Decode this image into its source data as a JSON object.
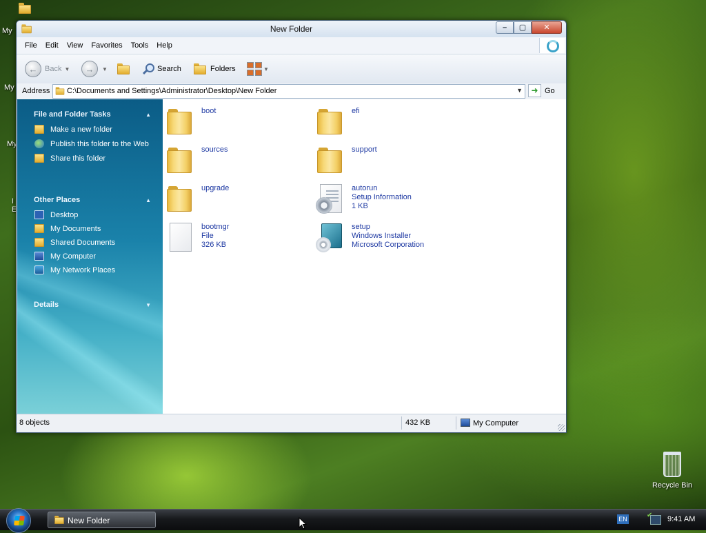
{
  "desktop": {
    "icons": [
      {
        "label": "My",
        "name": "desktop-icon-my-documents"
      },
      {
        "label": "My",
        "name": "desktop-icon-my-computer"
      },
      {
        "label": "My",
        "name": "desktop-icon-my-network"
      },
      {
        "label": "I E",
        "name": "desktop-icon-internet-explorer"
      }
    ],
    "recycle_bin": "Recycle Bin"
  },
  "window": {
    "title": "New Folder",
    "menu": [
      "File",
      "Edit",
      "View",
      "Favorites",
      "Tools",
      "Help"
    ],
    "toolbar": {
      "back": "Back",
      "search": "Search",
      "folders": "Folders"
    },
    "address": {
      "label": "Address",
      "path": "C:\\Documents and Settings\\Administrator\\Desktop\\New Folder",
      "go": "Go"
    },
    "taskpane": {
      "file_tasks": {
        "title": "File and Folder Tasks",
        "items": [
          "Make a new folder",
          "Publish this folder to the Web",
          "Share this folder"
        ]
      },
      "other_places": {
        "title": "Other Places",
        "items": [
          "Desktop",
          "My Documents",
          "Shared Documents",
          "My Computer",
          "My Network Places"
        ]
      },
      "details": {
        "title": "Details"
      }
    },
    "files": [
      {
        "name": "boot",
        "line2": "",
        "line3": "",
        "type": "folder"
      },
      {
        "name": "efi",
        "line2": "",
        "line3": "",
        "type": "folder"
      },
      {
        "name": "sources",
        "line2": "",
        "line3": "",
        "type": "folder"
      },
      {
        "name": "support",
        "line2": "",
        "line3": "",
        "type": "folder"
      },
      {
        "name": "upgrade",
        "line2": "",
        "line3": "",
        "type": "folder"
      },
      {
        "name": "autorun",
        "line2": "Setup Information",
        "line3": "1 KB",
        "type": "setup-info"
      },
      {
        "name": "bootmgr",
        "line2": "File",
        "line3": "326 KB",
        "type": "file"
      },
      {
        "name": "setup",
        "line2": "Windows Installer",
        "line3": "Microsoft Corporation",
        "type": "installer"
      }
    ],
    "status": {
      "objects": "8 objects",
      "size": "432 KB",
      "location": "My Computer"
    }
  },
  "taskbar": {
    "task": "New Folder",
    "lang": "EN",
    "clock": "9:41 AM"
  }
}
